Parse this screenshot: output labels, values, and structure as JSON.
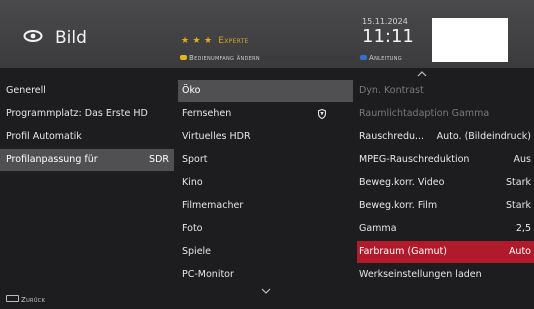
{
  "header": {
    "title": "Bild",
    "icon": "eye-icon",
    "level_stars": "★ ★ ★",
    "level_label": "Experte",
    "hint_yellow": "Bedienumfang ändern",
    "hint_blue": "Anleitung",
    "date": "15.11.2024",
    "time": "11:11",
    "colors": {
      "yellow": "#e3b51c",
      "blue": "#2f6fd0",
      "red": "#c0263a",
      "green": "#2b8a3e"
    }
  },
  "column1": {
    "items": [
      {
        "label": "Generell",
        "value": ""
      },
      {
        "label": "Programmplatz: Das Erste HD",
        "value": ""
      },
      {
        "label": "Profil Automatik",
        "value": ""
      },
      {
        "label": "Profilanpassung für",
        "value": "SDR",
        "selected": true
      }
    ]
  },
  "column2": {
    "items": [
      {
        "label": "Öko",
        "selected": true
      },
      {
        "label": "Fernsehen",
        "badge": "shield-icon"
      },
      {
        "label": "Virtuelles HDR"
      },
      {
        "label": "Sport"
      },
      {
        "label": "Kino"
      },
      {
        "label": "Filmemacher"
      },
      {
        "label": "Foto"
      },
      {
        "label": "Spiele"
      },
      {
        "label": "PC-Monitor"
      }
    ]
  },
  "column3": {
    "items": [
      {
        "label": "Dyn. Kontrast",
        "value": "",
        "disabled": true
      },
      {
        "label": "Raumlichtadaption Gamma",
        "value": "",
        "disabled": true
      },
      {
        "label": "Rauschredu...",
        "value": "Auto. (Bildeindruck)"
      },
      {
        "label": "MPEG-Rauschreduktion",
        "value": "Aus"
      },
      {
        "label": "Beweg.korr. Video",
        "value": "Stark"
      },
      {
        "label": "Beweg.korr. Film",
        "value": "Stark"
      },
      {
        "label": "Gamma",
        "value": "2,5"
      },
      {
        "label": "Farbraum (Gamut)",
        "value": "Auto",
        "selected": true
      },
      {
        "label": "Werkseinstellungen laden",
        "value": ""
      }
    ]
  },
  "footer": {
    "back_label": "Zurück"
  }
}
